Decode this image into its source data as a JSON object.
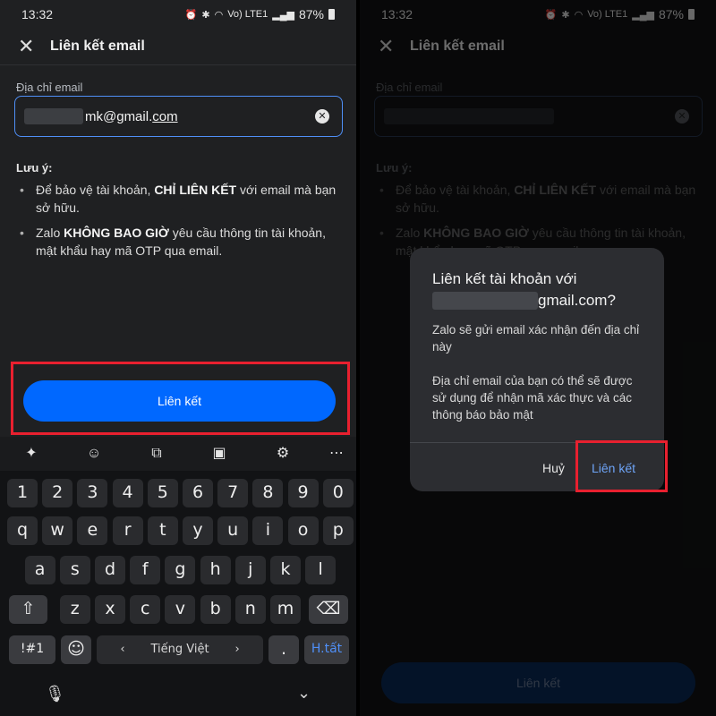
{
  "status": {
    "time": "13:32",
    "network": "Vo) LTE1",
    "battery": "87%"
  },
  "header": {
    "title": "Liên kết email"
  },
  "form": {
    "field_label": "Địa chỉ email",
    "email_visible_part": "mk@gmail.",
    "email_visible_tail": "com"
  },
  "note": {
    "title": "Lưu ý:",
    "items": [
      {
        "pre": "Để bảo vệ tài khoản, ",
        "bold": "CHỈ LIÊN KẾT",
        "post": " với email mà bạn sở hữu."
      },
      {
        "pre": "Zalo ",
        "bold": "KHÔNG BAO GIỜ",
        "post": " yêu cầu thông tin tài khoản, mật khẩu hay mã OTP qua email."
      }
    ]
  },
  "primary_button": {
    "label": "Liên kết"
  },
  "keyboard": {
    "toolbar_icons": [
      "sparkle-icon",
      "emoji-icon",
      "translate-icon",
      "clipboard-icon",
      "gear-icon",
      "more-icon"
    ],
    "rows": [
      [
        "1",
        "2",
        "3",
        "4",
        "5",
        "6",
        "7",
        "8",
        "9",
        "0"
      ],
      [
        "q",
        "w",
        "e",
        "r",
        "t",
        "y",
        "u",
        "i",
        "o",
        "p"
      ],
      [
        "a",
        "s",
        "d",
        "f",
        "g",
        "h",
        "j",
        "k",
        "l"
      ],
      [
        "z",
        "x",
        "c",
        "v",
        "b",
        "n",
        "m"
      ]
    ],
    "symbols_key": "!#1",
    "space_label": "Tiếng Việt",
    "period": ".",
    "done_key": "H.tất"
  },
  "dialog": {
    "title": "Liên kết tài khoản với",
    "email_visible": "gmail.com?",
    "body_1": "Zalo sẽ gửi email xác nhận đến địa chỉ này",
    "body_2": "Địa chỉ email của bạn có thể sẽ được sử dụng để nhận mã xác thực và các thông báo bảo mật",
    "cancel": "Huỷ",
    "confirm": "Liên kết"
  },
  "colors": {
    "accent": "#0068ff",
    "highlight": "#e8202f",
    "background": "#1f2022"
  }
}
